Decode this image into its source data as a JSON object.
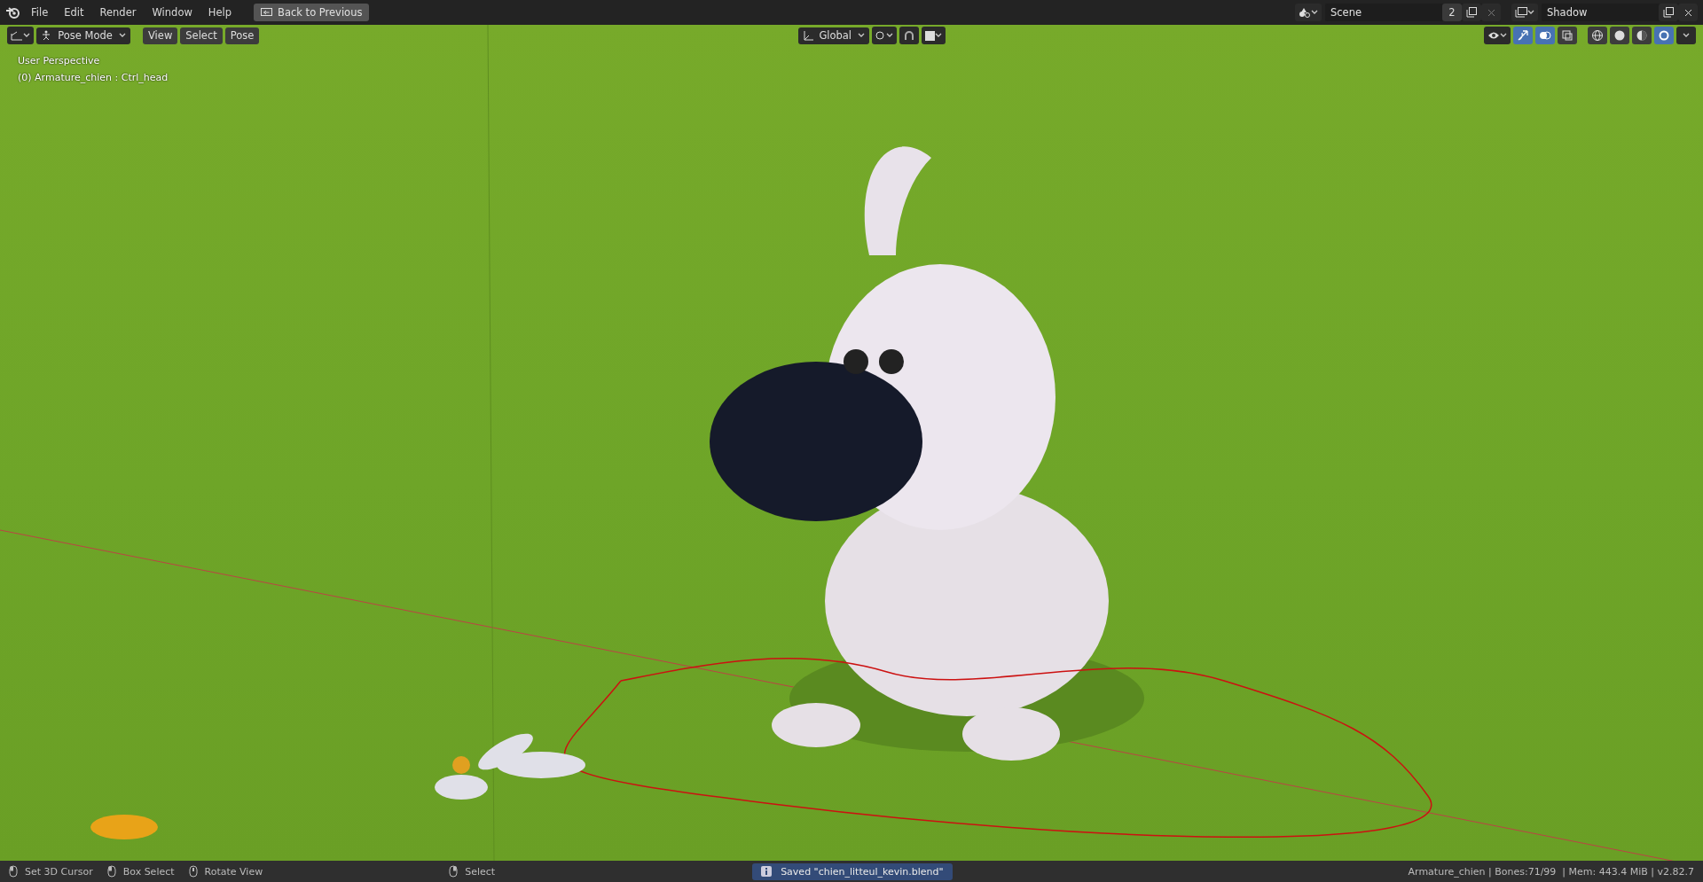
{
  "topbar": {
    "menus": [
      "File",
      "Edit",
      "Render",
      "Window",
      "Help"
    ],
    "back_button": "Back to Previous",
    "scene": {
      "name": "Scene",
      "users": "2"
    },
    "view_layer": {
      "name": "Shadow"
    }
  },
  "header": {
    "mode": "Pose Mode",
    "menus": [
      "View",
      "Select",
      "Pose"
    ],
    "orientation": "Global",
    "toggles": [
      {
        "kind": "gizmo",
        "selected": true
      },
      {
        "kind": "overlay",
        "selected": true
      },
      {
        "kind": "xray",
        "selected": false
      }
    ],
    "shading_modes": [
      {
        "kind": "wireframe",
        "selected": false
      },
      {
        "kind": "solid",
        "selected": false
      },
      {
        "kind": "material",
        "selected": false
      },
      {
        "kind": "rendered",
        "selected": true
      }
    ]
  },
  "viewport": {
    "view_name": "User Perspective",
    "object_info": "(0) Armature_chien : Ctrl_head"
  },
  "status_bar": {
    "hints": [
      {
        "kind": "left",
        "label": "Set 3D Cursor"
      },
      {
        "kind": "box",
        "label": "Box Select"
      },
      {
        "kind": "middle",
        "label": "Rotate View"
      },
      {
        "kind": "right",
        "label": "Select"
      }
    ],
    "message": "Saved \"chien_litteul_kevin.blend\"",
    "stats": "Armature_chien | Bones:71/99  | Mem: 443.4 MiB | v2.82.7"
  }
}
